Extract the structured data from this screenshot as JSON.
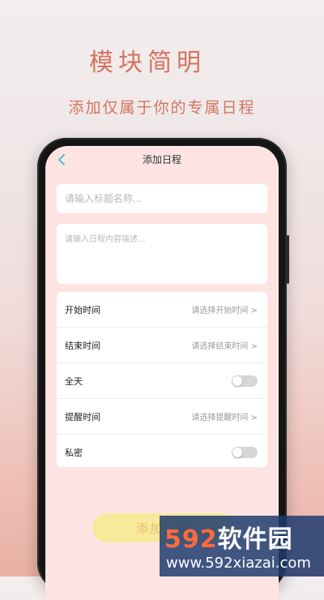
{
  "hero": {
    "title": "模块简明",
    "subtitle": "添加仅属于你的专属日程"
  },
  "topbar": {
    "back_icon": "chevron-left-icon",
    "title": "添加日程"
  },
  "form": {
    "title_placeholder": "请输入标题名称...",
    "title_value": "",
    "desc_placeholder": "请输入日程内容描述...",
    "desc_value": ""
  },
  "settings": {
    "start_label": "开始时间",
    "start_value": "请选择开始时间 >",
    "end_label": "结束时间",
    "end_value": "请选择结束时间 >",
    "allday_label": "全天",
    "allday_on": false,
    "remind_label": "提醒时间",
    "remind_value": "请选择提醒时间 >",
    "private_label": "私密",
    "private_on": false
  },
  "submit_label": "添加日程",
  "watermark": {
    "logo_num": "592",
    "logo_text": "软件园",
    "url": "www.592xiazai.com"
  },
  "colors": {
    "accent": "#4ac4d6",
    "hero_text": "#d2755f",
    "screen_bg": "#fde4e3",
    "button_bg": "#f9e99a"
  }
}
